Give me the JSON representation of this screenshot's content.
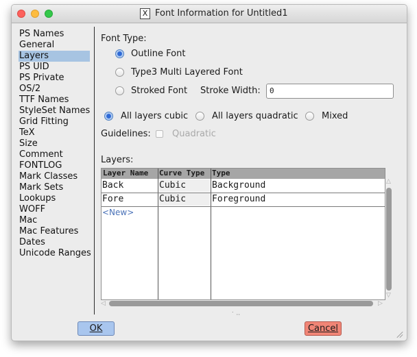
{
  "window": {
    "title": "Font Information for Untitled1",
    "title_icon": "X"
  },
  "sidebar": {
    "items": [
      "PS Names",
      "General",
      "Layers",
      "PS UID",
      "PS Private",
      "OS/2",
      "TTF Names",
      "StyleSet Names",
      "Grid Fitting",
      "TeX",
      "Size",
      "Comment",
      "FONTLOG",
      "Mark Classes",
      "Mark Sets",
      "Lookups",
      "WOFF",
      "Mac",
      "Mac Features",
      "Dates",
      "Unicode Ranges"
    ],
    "selected": "Layers"
  },
  "font_type": {
    "label": "Font Type:",
    "outline": "Outline Font",
    "type3": "Type3 Multi Layered Font",
    "stroked": "Stroked Font",
    "selected": "Outline Font",
    "stroke_width_label": "Stroke Width:",
    "stroke_width_value": "0"
  },
  "layers_mode": {
    "cubic": "All layers cubic",
    "quadratic": "All layers quadratic",
    "mixed": "Mixed",
    "selected": "All layers cubic"
  },
  "guidelines": {
    "label": "Guidelines:",
    "quadratic": "Quadratic",
    "checked": false
  },
  "layers": {
    "label": "Layers:",
    "columns": [
      "Layer Name",
      "Curve Type",
      "Type"
    ],
    "rows": [
      {
        "name": "Back",
        "curve": "Cubic",
        "type": "Background"
      },
      {
        "name": "Fore",
        "curve": "Cubic",
        "type": "Foreground"
      }
    ],
    "new_label": "<New>"
  },
  "buttons": {
    "ok": "OK",
    "cancel": "Cancel"
  }
}
